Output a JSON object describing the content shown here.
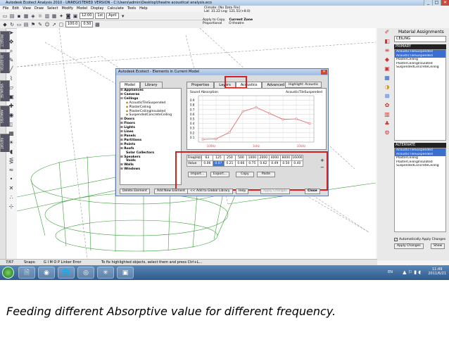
{
  "window": {
    "title": "Autodesk Ecotect Analysis 2010 - UNREGISTERED VERSION - C:\\Users\\admin\\Desktop\\theatre acoustical analysis.eco",
    "buttons": [
      "_",
      "□",
      "✕"
    ]
  },
  "menu": [
    "File",
    "Edit",
    "View",
    "Draw",
    "Select",
    "Modify",
    "Model",
    "Display",
    "Calculate",
    "Tools",
    "Help"
  ],
  "toolbar": {
    "time": "12:00",
    "date": "1st",
    "month": "April",
    "offset": "100.0",
    "ratio": "0.50",
    "climate_label": "Climate: [No Data File]",
    "latlong": "Lat: 31.22   Lng: 121.51(+8.0)",
    "apply_label": "Apply to Copy",
    "proportional": "Proportional",
    "current_zone_label": "Current Zone",
    "current_zone": "O theatre"
  },
  "left_tabs": [
    "PROJECT",
    "3D EDITOR",
    "VISUALISE",
    "ANALYSIS",
    "REPORT"
  ],
  "right_panel": {
    "title": "Material Assignments",
    "category": "CEILING",
    "primary_header": "PRIMARY",
    "primary_items": [
      "AcousticTileSuspended",
      "AcousticTileSuspended",
      "PlasterCeiling",
      "PlasterCeilingInsulated",
      "SuspendedConcreteCeiling"
    ],
    "alternate_header": "ALTERNATE",
    "alternate_items": [
      "AcousticTileSuspended",
      "AcousticTileSuspended",
      "PlasterCeiling",
      "PlasterCeilingInsulated",
      "SuspendedConcreteCeiling"
    ],
    "auto_apply": "Automatically Apply Changes",
    "apply_button": "Apply Changes",
    "show_button": "Show"
  },
  "dialog": {
    "title": "Autodesk Ecotect - Elements in Current Model",
    "left_tabs": [
      "Model",
      "Library"
    ],
    "tree": [
      "Appliances",
      "Cameras",
      "Ceilings",
      "AcousticTileSuspended",
      "PlasterCeiling",
      "PlasterCeilingInsulated",
      "SuspendedConcreteCeiling",
      "Doors",
      "Floors",
      "Lights",
      "Lines",
      "Panels",
      "Partitions",
      "Points",
      "Roofs",
      "Solar Collectors",
      "Speakers",
      "Voids",
      "Walls",
      "Windows"
    ],
    "right_tabs": [
      "Properties",
      "Layers",
      "Acoustics",
      "Advanced Export"
    ],
    "highlight_button": "Highlight: Acoustic",
    "grid": {
      "freq_label": "Freq(Hz)",
      "value_label": "Value",
      "frequencies": [
        "63",
        "125",
        "250",
        "500",
        "1000",
        "2000",
        "4000",
        "8000",
        "16000"
      ],
      "values": [
        "0.06",
        "0.07",
        "0.21",
        "0.66",
        "0.75",
        "0.62",
        "0.49",
        "0.50",
        "0.40"
      ]
    },
    "sub_buttons": [
      "Import...",
      "Export...",
      "Copy",
      "Paste"
    ],
    "bottom_buttons": [
      "Delete Element",
      "Add New Element",
      "<< Add to Global Library",
      "Help",
      "Apply Changes",
      "Close"
    ]
  },
  "chart_data": {
    "type": "line",
    "title": "Sound Absorption",
    "subtitle": "AcousticTileSuspended",
    "x": [
      "63",
      "125",
      "250",
      "500",
      "1000",
      "2000",
      "4000",
      "8000",
      "16000"
    ],
    "series": [
      {
        "values": [
          0.06,
          0.07,
          0.21,
          0.66,
          0.75,
          0.62,
          0.49,
          0.5,
          0.4
        ]
      }
    ],
    "ylim": [
      0,
      1.0
    ],
    "yticks": [
      "0.9",
      "0.8",
      "0.7",
      "0.6",
      "0.5",
      "0.4",
      "0.3",
      "0.2",
      "0.1"
    ],
    "xband_labels": [
      "100Hz",
      "1kHz",
      "10kHz"
    ],
    "grid": true,
    "color": "#e06060"
  },
  "statusbar": {
    "count": "7/67",
    "snaps": "Snaps:",
    "snap_codes": "G I      M O P    Linker Error",
    "hint": "To fix highlighted objects, select them and press Ctrl+L..."
  },
  "taskbar": {
    "apps": [
      "🗎",
      "◉",
      "🌐",
      "◎",
      "✳",
      "▣"
    ],
    "lang": "EN",
    "time": "11:49",
    "date": "2011/6/21"
  },
  "caption": "Feeding different Absorptive value for different frequency."
}
